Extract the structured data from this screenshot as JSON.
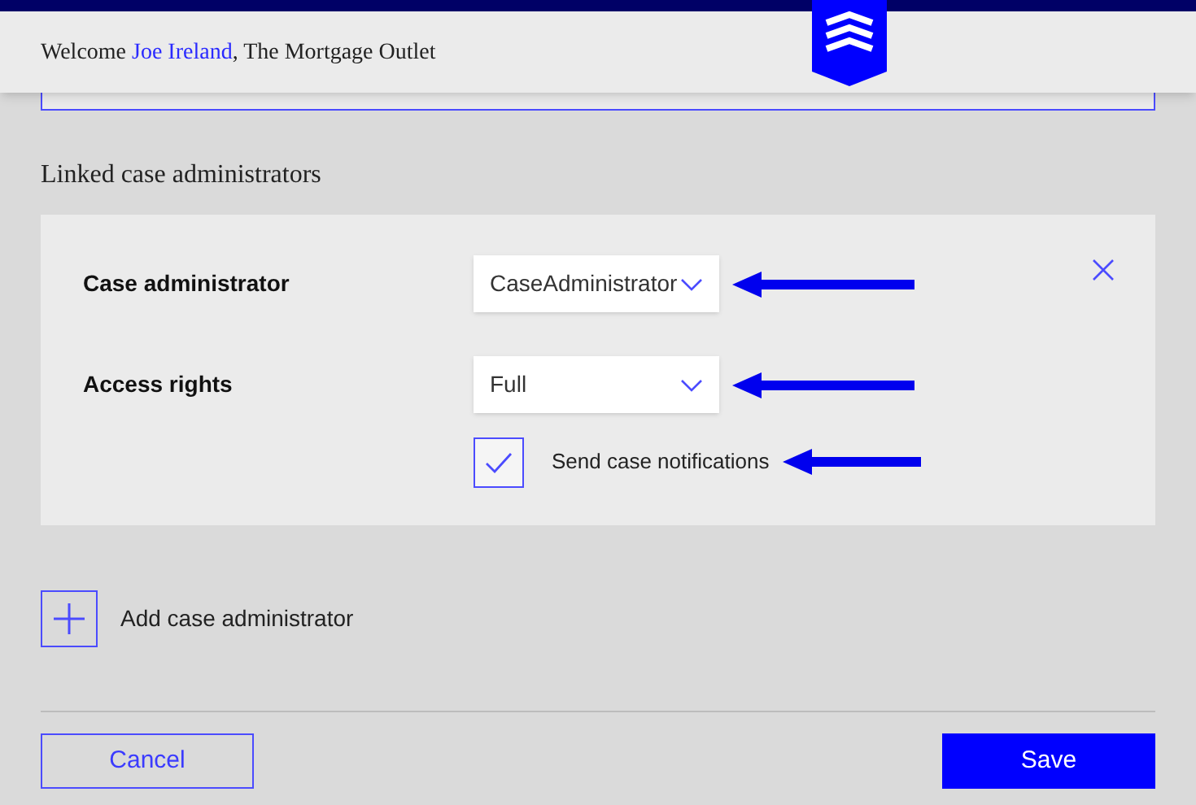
{
  "header": {
    "welcome": "Welcome",
    "user": "Joe Ireland",
    "company": ", The Mortgage Outlet"
  },
  "section": {
    "title": "Linked case administrators"
  },
  "administrator": {
    "rows": [
      {
        "kind": "dropdown",
        "label": "Case administrator",
        "value": "CaseAdministrator",
        "arrow": true
      },
      {
        "kind": "dropdown",
        "label": "Access rights",
        "value": "Full",
        "arrow": true
      },
      {
        "kind": "checkbox",
        "label": "Send case notifications",
        "checked": true,
        "arrow": true
      }
    ]
  },
  "add_button": {
    "label": "Add case administrator"
  },
  "buttons": {
    "cancel": "Cancel",
    "save": "Save"
  }
}
